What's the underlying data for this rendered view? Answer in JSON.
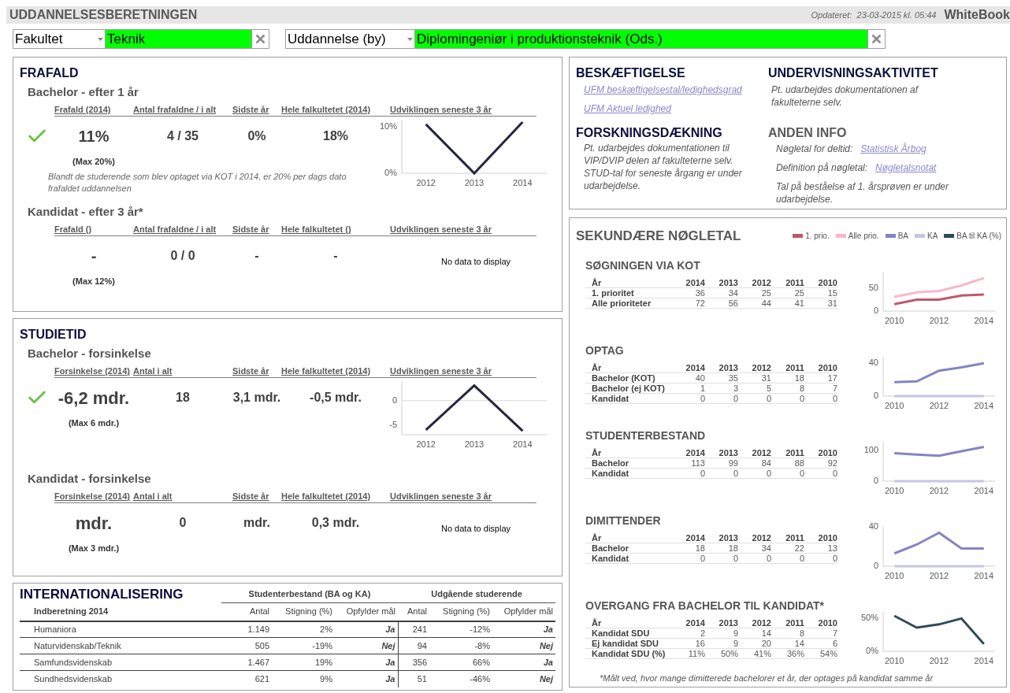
{
  "header": {
    "title": "UDDANNELSESBERETNINGEN",
    "updated": "Opdateret:  23-03-2015 kl. 05:44",
    "brand": "WhiteBook"
  },
  "filters": [
    {
      "label": "Fakultet",
      "value": "Teknik"
    },
    {
      "label": "Uddannelse (by)",
      "value": "Diplomingeniør i produktionsteknik (Ods.)"
    }
  ],
  "sections": [
    {
      "title": "FRAFALD",
      "blocks": [
        {
          "subtitle": "Bachelor - efter 1 år",
          "columns": [
            "Frafald (2014)",
            "Antal frafaldne / i alt",
            "Sidste år",
            "Hele falkultetet  (2014)",
            "Udviklingen seneste 3 år"
          ],
          "ok": true,
          "values": [
            "11%",
            "4 / 35",
            "0%",
            "18%"
          ],
          "max": "(Max 20%)",
          "note": "Blandt de studerende som blev optaget via KOT i 2014, er 20% per dags dato frafaldet uddannelsen",
          "chart_data": {
            "type": "line",
            "categories": [
              "2012",
              "2013",
              "2014"
            ],
            "ylim": [
              0,
              11.5
            ],
            "yticks": [
              {
                "value": 0,
                "label": "0%"
              },
              {
                "value": 10,
                "label": "10%"
              }
            ],
            "series": [
              {
                "color": "#262640",
                "values": [
                  10.5,
                  0,
                  11
                ]
              }
            ]
          }
        },
        {
          "subtitle": "Kandidat - efter 3 år*",
          "columns": [
            "Frafald ()",
            "Antal frafaldne / i alt",
            "Sidste år",
            "Hele falkultetet  ()",
            "Udviklingen seneste 3 år"
          ],
          "ok": false,
          "values": [
            "-",
            "0 / 0",
            "-",
            "-"
          ],
          "max": "(Max 12%)",
          "no_data": "No data to display"
        }
      ]
    },
    {
      "title": "STUDIETID",
      "blocks": [
        {
          "subtitle": "Bachelor - forsinkelse",
          "columns": [
            "Forsinkelse (2014)",
            "Antal i alt",
            "Sidste år",
            "Hele falkultetet  (2014)",
            "Udviklingen seneste 3 år"
          ],
          "ok": true,
          "values": [
            "-6,2 mdr.",
            "18",
            "3,1 mdr.",
            "-0,5 mdr."
          ],
          "max": "(Max 6 mdr.)",
          "chart_data": {
            "type": "line",
            "categories": [
              "2012",
              "2013",
              "2014"
            ],
            "ylim": [
              -7,
              4
            ],
            "yticks": [
              -5,
              0
            ],
            "series": [
              {
                "color": "#262640",
                "values": [
                  -6,
                  3.1,
                  -6.2
                ]
              }
            ]
          }
        },
        {
          "subtitle": "Kandidat - forsinkelse",
          "columns": [
            "Forsinkelse (2014)",
            "Antal i alt",
            "Sidste år",
            "Hele falkultetet  (2014)",
            "Udviklingen seneste 3 år"
          ],
          "ok": false,
          "values": [
            "mdr.",
            "0",
            "mdr.",
            "0,3 mdr."
          ],
          "max": "(Max 3 mdr.)",
          "no_data": "No data to display"
        }
      ]
    }
  ],
  "internationalisering": {
    "title": "INTERNATIONALISERING",
    "groups": [
      "Studenterbestand (BA og KA)",
      "Udgående studerende"
    ],
    "row_header": "Indberetning 2014",
    "columns": [
      "Antal",
      "Stigning (%)",
      "Opfylder mål",
      "Antal",
      "Stigning (%)",
      "Opfylder mål"
    ],
    "rows": [
      {
        "name": "Humaniora",
        "cells": [
          "1.149",
          "2%",
          "Ja",
          "241",
          "-12%",
          "Ja"
        ]
      },
      {
        "name": "Naturvidenskab/Teknik",
        "cells": [
          "505",
          "-19%",
          "Nej",
          "94",
          "-8%",
          "Nej"
        ]
      },
      {
        "name": "Samfundsvidenskab",
        "cells": [
          "1.467",
          "19%",
          "Ja",
          "356",
          "66%",
          "Ja"
        ]
      },
      {
        "name": "Sundhedsvidenskab",
        "cells": [
          "621",
          "9%",
          "Ja",
          "51",
          "-46%",
          "Nej"
        ]
      }
    ]
  },
  "info": {
    "beskaeftigelse": {
      "title": "BESKÆFTIGELSE",
      "links": [
        "UFM beskæftigelsestal/ledighedsgrad",
        "UFM Aktuel ledighed"
      ]
    },
    "undervisning": {
      "title": "UNDERVISNINGSAKTIVITET",
      "text": "Pt. udarbejdes dokumentationen af fakulteterne selv."
    },
    "forskning": {
      "title": "FORSKNINGSDÆKNING",
      "text": "Pt. udarbejdes dokumentationen til VIP/DVIP delen af fakulteterne selv. STUD-tal for seneste årgang er under udarbejdelse."
    },
    "anden": {
      "title": "ANDEN INFO",
      "items": [
        {
          "label": "Nøgletal for deltid:",
          "link": "Statistisk Årbog"
        },
        {
          "label": "Definition på nøgletal:",
          "link": "Nøgletalsnotat"
        },
        {
          "label": "Tal på beståelse af 1. årsprøven er under udarbejdelse."
        }
      ]
    }
  },
  "secondary": {
    "title": "SEKUNDÆRE NØGLETAL",
    "legend": [
      {
        "label": "1. prio.",
        "color": "#c0586a"
      },
      {
        "label": "Alle prio.",
        "color": "#f7b9c5"
      },
      {
        "label": "BA",
        "color": "#8584c2"
      },
      {
        "label": "KA",
        "color": "#c5c5e3"
      },
      {
        "label": "BA til KA (%)",
        "color": "#2f4b59"
      }
    ],
    "sections": [
      {
        "title": "SØGNINGEN VIA KOT",
        "year_label": "År",
        "years": [
          "2014",
          "2013",
          "2012",
          "2011",
          "2010"
        ],
        "rows": [
          {
            "label": "1. prioritet",
            "values": [
              "36",
              "34",
              "25",
              "25",
              "15"
            ]
          },
          {
            "label": "Alle prioriteter",
            "values": [
              "72",
              "56",
              "44",
              "41",
              "31"
            ]
          }
        ],
        "chart_data": {
          "type": "line",
          "x": [
            2010,
            2011,
            2012,
            2013,
            2014
          ],
          "xlim": [
            2009.5,
            2014.5
          ],
          "xticks": [
            2010,
            2012,
            2014
          ],
          "ylim": [
            0,
            86
          ],
          "yticks": [
            0,
            50
          ],
          "series": [
            {
              "color": "#c0586a",
              "values": [
                15,
                25,
                25,
                34,
                36
              ]
            },
            {
              "color": "#f7b9c5",
              "values": [
                31,
                41,
                44,
                56,
                72
              ]
            }
          ]
        }
      },
      {
        "title": "OPTAG",
        "year_label": "År",
        "years": [
          "2014",
          "2013",
          "2012",
          "2011",
          "2010"
        ],
        "rows": [
          {
            "label": "Bachelor (KOT)",
            "values": [
              "40",
              "35",
              "31",
              "18",
              "17"
            ]
          },
          {
            "label": "Bachelor (ej KOT)",
            "values": [
              "1",
              "3",
              "5",
              "8",
              "7"
            ]
          },
          {
            "label": "Kandidat",
            "values": [
              "0",
              "0",
              "0",
              "0",
              "0"
            ]
          }
        ],
        "chart_data": {
          "type": "line",
          "x": [
            2010,
            2011,
            2012,
            2013,
            2014
          ],
          "xlim": [
            2009.5,
            2014.5
          ],
          "xticks": [
            2010,
            2012,
            2014
          ],
          "ylim": [
            0,
            48
          ],
          "yticks": [
            0,
            40
          ],
          "series": [
            {
              "color": "#8584c2",
              "values": [
                17,
                18,
                31,
                35,
                40
              ]
            },
            {
              "color": "#c5c5e3",
              "values": [
                0,
                0,
                0,
                0,
                0
              ]
            }
          ]
        }
      },
      {
        "title": "STUDENTERBESTAND",
        "year_label": "År",
        "years": [
          "2014",
          "2013",
          "2012",
          "2011",
          "2010"
        ],
        "rows": [
          {
            "label": "Bachelor",
            "values": [
              "113",
              "99",
              "84",
              "88",
              "92"
            ]
          },
          {
            "label": "Kandidat",
            "values": [
              "0",
              "0",
              "0",
              "0",
              "0"
            ]
          }
        ],
        "chart_data": {
          "type": "line",
          "x": [
            2010,
            2011,
            2012,
            2013,
            2014
          ],
          "xlim": [
            2009.5,
            2014.5
          ],
          "xticks": [
            2010,
            2012,
            2014
          ],
          "ylim": [
            0,
            130
          ],
          "yticks": [
            0,
            100
          ],
          "series": [
            {
              "color": "#8584c2",
              "values": [
                92,
                88,
                84,
                99,
                113
              ]
            },
            {
              "color": "#c5c5e3",
              "values": [
                0,
                0,
                0,
                0,
                0
              ]
            }
          ]
        }
      },
      {
        "title": "DIMITTENDER",
        "year_label": "År",
        "years": [
          "2014",
          "2013",
          "2012",
          "2011",
          "2010"
        ],
        "rows": [
          {
            "label": "Bachelor",
            "values": [
              "18",
              "18",
              "34",
              "22",
              "13"
            ]
          },
          {
            "label": "Kandidat",
            "values": [
              "0",
              "0",
              "0",
              "0",
              "0"
            ]
          }
        ],
        "chart_data": {
          "type": "line",
          "x": [
            2010,
            2011,
            2012,
            2013,
            2014
          ],
          "xlim": [
            2009.5,
            2014.5
          ],
          "xticks": [
            2010,
            2012,
            2014
          ],
          "ylim": [
            0,
            40
          ],
          "yticks": [
            0,
            40
          ],
          "series": [
            {
              "color": "#8584c2",
              "values": [
                13,
                22,
                34,
                18,
                18
              ]
            },
            {
              "color": "#c5c5e3",
              "values": [
                0,
                0,
                0,
                0,
                0
              ]
            }
          ]
        }
      },
      {
        "title": "OVERGANG FRA BACHELOR TIL KANDIDAT*",
        "year_label": "År",
        "years": [
          "2014",
          "2013",
          "2012",
          "2011",
          "2010"
        ],
        "rows": [
          {
            "label": "Kandidat SDU",
            "values": [
              "2",
              "9",
              "14",
              "8",
              "7"
            ]
          },
          {
            "label": "Ej kandidat SDU",
            "values": [
              "16",
              "9",
              "20",
              "14",
              "6"
            ]
          },
          {
            "label": "Kandidat SDU (%)",
            "values": [
              "11%",
              "50%",
              "41%",
              "36%",
              "54%"
            ]
          }
        ],
        "chart_data": {
          "type": "line",
          "x": [
            2010,
            2011,
            2012,
            2013,
            2014
          ],
          "xlim": [
            2009.5,
            2014.5
          ],
          "xticks": [
            2010,
            2012,
            2014
          ],
          "ylim": [
            0,
            60
          ],
          "yticks": [
            {
              "value": 0,
              "label": "0%"
            },
            {
              "value": 50,
              "label": "50%"
            }
          ],
          "series": [
            {
              "color": "#2f4b59",
              "values": [
                54,
                36,
                41,
                50,
                11
              ]
            }
          ]
        }
      }
    ],
    "footnote": "*Målt ved, hvor mange dimitterede bachelorer et år, der optages på kandidat samme år"
  }
}
